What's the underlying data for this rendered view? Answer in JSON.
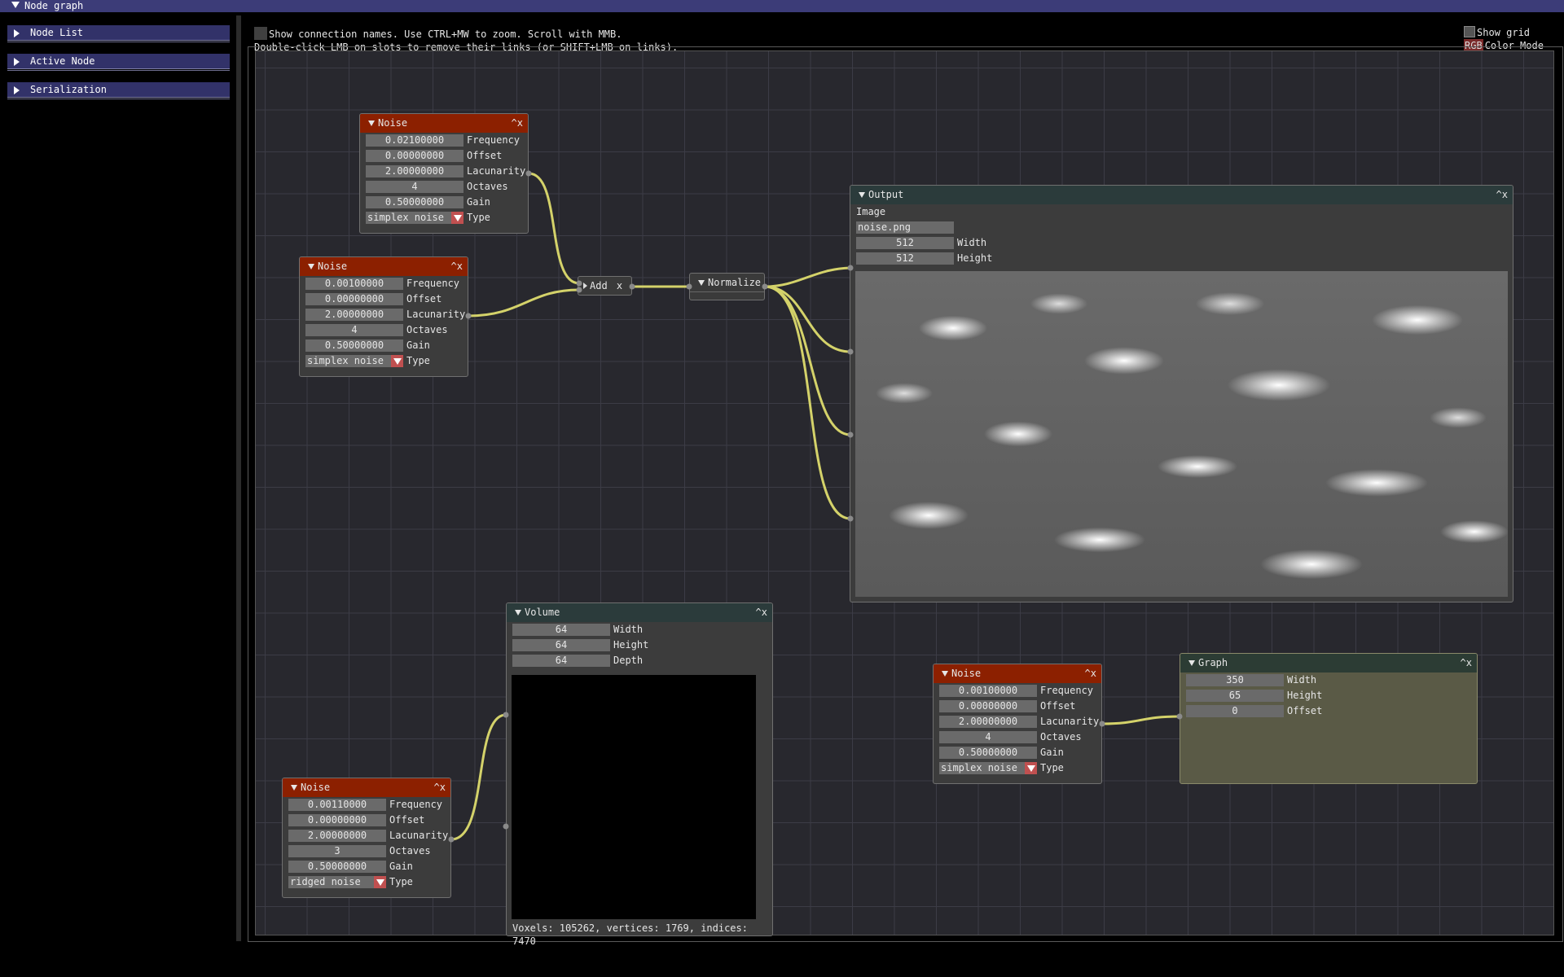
{
  "window": {
    "title": "Node graph"
  },
  "sidebar": {
    "items": [
      {
        "label": "Node List"
      },
      {
        "label": "Active Node"
      },
      {
        "label": "Serialization"
      }
    ]
  },
  "help": {
    "line1": "Show connection names.  Use CTRL+MW to zoom. Scroll with MMB.",
    "line2": "Double-click LMB on slots to remove their links (or SHIFT+LMB on links)."
  },
  "options": {
    "show_grid": "Show grid",
    "rgb": "RGB",
    "color_mode": "Color Mode"
  },
  "nodes": {
    "noise1": {
      "title": "Noise",
      "close": "^x",
      "frequency": "0.02100000",
      "offset": "0.00000000",
      "lacunarity": "2.00000000",
      "octaves": "4",
      "gain": "0.50000000",
      "type": "simplex noise"
    },
    "noise2": {
      "title": "Noise",
      "close": "^x",
      "frequency": "0.00100000",
      "offset": "0.00000000",
      "lacunarity": "2.00000000",
      "octaves": "4",
      "gain": "0.50000000",
      "type": "simplex noise"
    },
    "noise3": {
      "title": "Noise",
      "close": "^x",
      "frequency": "0.00110000",
      "offset": "0.00000000",
      "lacunarity": "2.00000000",
      "octaves": "3",
      "gain": "0.50000000",
      "type": "ridged noise"
    },
    "noise4": {
      "title": "Noise",
      "close": "^x",
      "frequency": "0.00100000",
      "offset": "0.00000000",
      "lacunarity": "2.00000000",
      "octaves": "4",
      "gain": "0.50000000",
      "type": "simplex noise"
    },
    "add": {
      "title": "Add",
      "close": "x"
    },
    "normalize": {
      "title": "Normalize"
    },
    "output": {
      "title": "Output",
      "close": "^x",
      "image_label": "Image",
      "filename": "noise.png",
      "width": "512",
      "height": "512"
    },
    "volume": {
      "title": "Volume",
      "close": "^x",
      "width": "64",
      "height": "64",
      "depth": "64",
      "stats": "Voxels: 105262, vertices: 1769, indices: 7470"
    },
    "graph": {
      "title": "Graph",
      "close": "^x",
      "width": "350",
      "height": "65",
      "offset": "0"
    }
  },
  "labels": {
    "frequency": "Frequency",
    "offset": "Offset",
    "lacunarity": "Lacunarity",
    "octaves": "Octaves",
    "gain": "Gain",
    "type": "Type",
    "width": "Width",
    "height": "Height",
    "depth": "Depth"
  },
  "colors": {
    "noise_header": "#8c2000",
    "wire": "#d4d26a",
    "grid": "#3c3c46",
    "canvas": "#28282e"
  }
}
